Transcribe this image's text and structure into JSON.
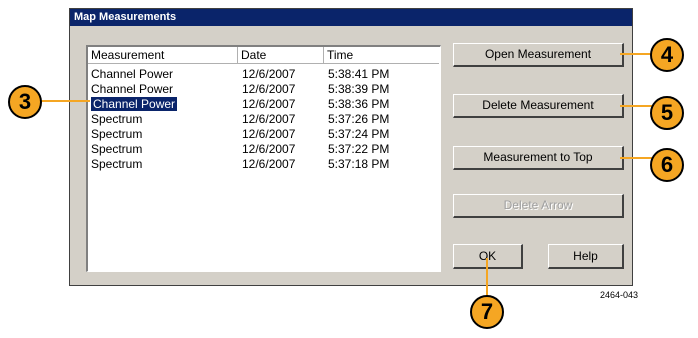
{
  "dialog": {
    "title": "Map Measurements",
    "list": {
      "columns": [
        "Measurement",
        "Date",
        "Time"
      ],
      "rows": [
        {
          "measurement": "Channel Power",
          "date": "12/6/2007",
          "time": "5:38:41 PM"
        },
        {
          "measurement": "Channel Power",
          "date": "12/6/2007",
          "time": "5:38:39 PM"
        },
        {
          "measurement": "Channel Power",
          "date": "12/6/2007",
          "time": "5:38:36 PM"
        },
        {
          "measurement": "Spectrum",
          "date": "12/6/2007",
          "time": "5:37:26 PM"
        },
        {
          "measurement": "Spectrum",
          "date": "12/6/2007",
          "time": "5:37:24 PM"
        },
        {
          "measurement": "Spectrum",
          "date": "12/6/2007",
          "time": "5:37:22 PM"
        },
        {
          "measurement": "Spectrum",
          "date": "12/6/2007",
          "time": "5:37:18 PM"
        }
      ],
      "selected_index": 2
    },
    "buttons": {
      "open": "Open Measurement",
      "delete": "Delete Measurement",
      "to_top": "Measurement to Top",
      "delete_arrow": "Delete Arrow",
      "ok": "OK",
      "help": "Help"
    }
  },
  "callouts": {
    "c3": "3",
    "c4": "4",
    "c5": "5",
    "c6": "6",
    "c7": "7"
  },
  "figure_id": "2464-043",
  "colors": {
    "titlebar": "#0a246a",
    "callout": "#f5a623",
    "dialog_bg": "#d4d0c8"
  }
}
